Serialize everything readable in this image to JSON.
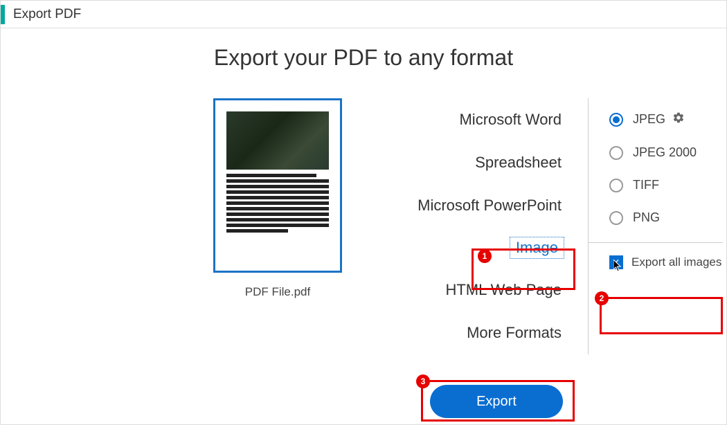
{
  "header": {
    "title": "Export PDF"
  },
  "heading": "Export your PDF to any format",
  "file": {
    "name": "PDF File.pdf"
  },
  "formats": {
    "word": "Microsoft Word",
    "spreadsheet": "Spreadsheet",
    "powerpoint": "Microsoft PowerPoint",
    "image": "Image",
    "html": "HTML Web Page",
    "more": "More Formats"
  },
  "subformats": {
    "jpeg": "JPEG",
    "jpeg2000": "JPEG 2000",
    "tiff": "TIFF",
    "png": "PNG",
    "selected": "jpeg"
  },
  "checkbox": {
    "export_all_images": "Export all images"
  },
  "buttons": {
    "export": "Export"
  },
  "annotations": {
    "one": "1",
    "two": "2",
    "three": "3"
  }
}
